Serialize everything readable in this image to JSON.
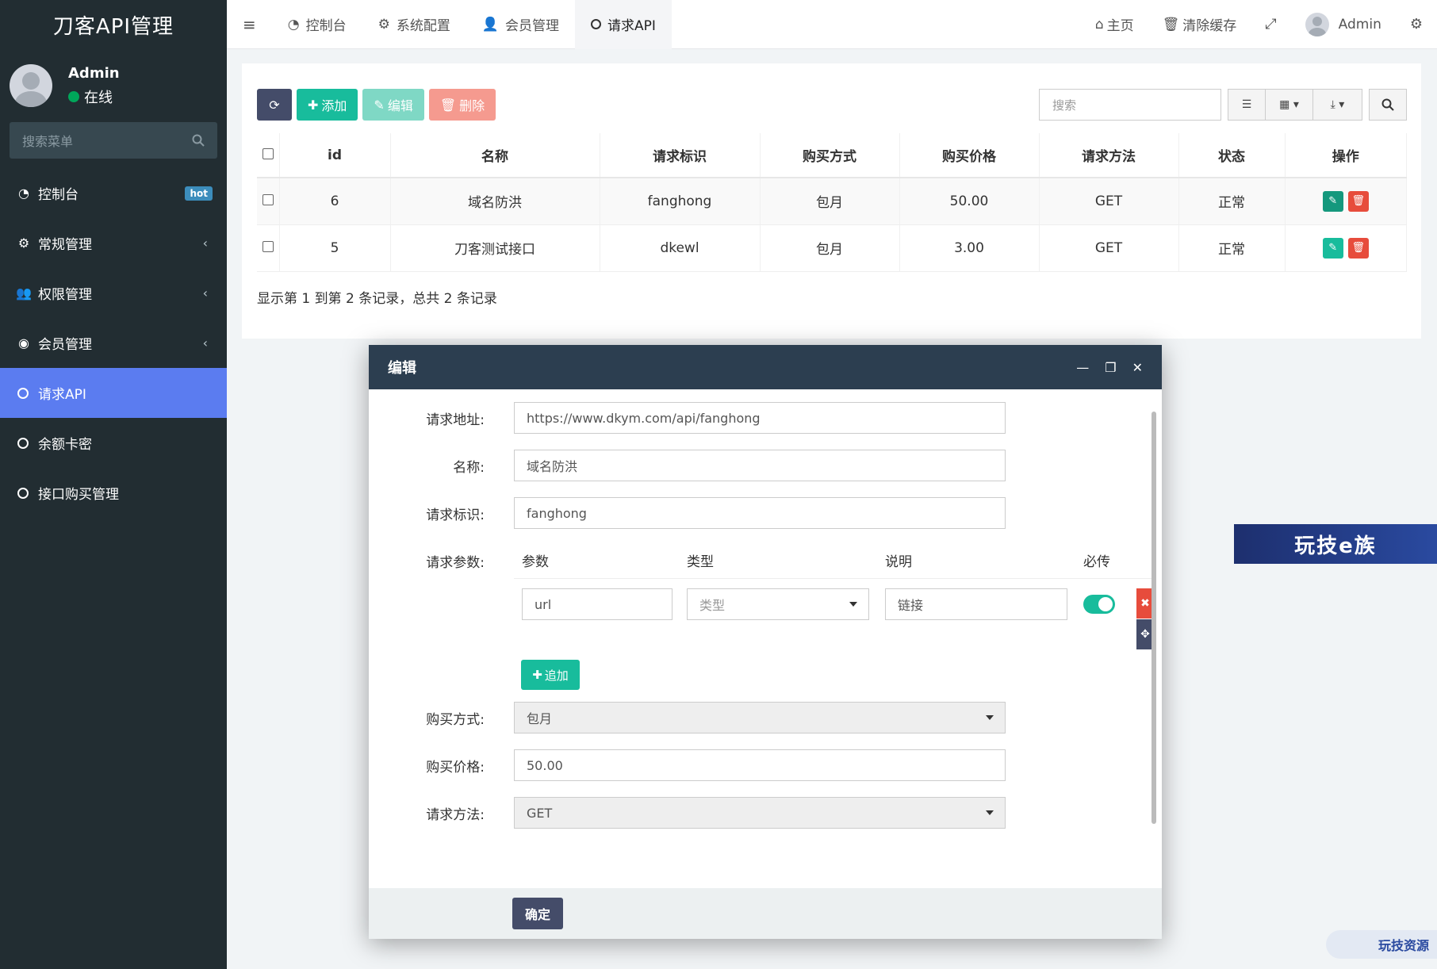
{
  "brand": {
    "title": "刀客API管理"
  },
  "user": {
    "name": "Admin",
    "status": "在线"
  },
  "sidebar": {
    "search_placeholder": "搜索菜单",
    "items": [
      {
        "label": "控制台",
        "icon": "dashboard-icon",
        "badge": "hot"
      },
      {
        "label": "常规管理",
        "icon": "cogs-icon"
      },
      {
        "label": "权限管理",
        "icon": "users-icon"
      },
      {
        "label": "会员管理",
        "icon": "user-circle-icon"
      },
      {
        "label": "请求API",
        "icon": "circle-icon",
        "active": true
      },
      {
        "label": "余额卡密",
        "icon": "circle-icon"
      },
      {
        "label": "接口购买管理",
        "icon": "circle-icon"
      }
    ]
  },
  "topbar": {
    "tabs": [
      {
        "label": "控制台",
        "icon": "dashboard-icon"
      },
      {
        "label": "系统配置",
        "icon": "gear-icon"
      },
      {
        "label": "会员管理",
        "icon": "user-icon"
      },
      {
        "label": "请求API",
        "icon": "circle-icon",
        "active": true
      }
    ],
    "home": "主页",
    "clear_cache": "清除缓存",
    "username": "Admin"
  },
  "toolbar": {
    "add_label": "添加",
    "edit_label": "编辑",
    "delete_label": "删除",
    "search_placeholder": "搜索"
  },
  "table": {
    "columns": [
      "id",
      "名称",
      "请求标识",
      "购买方式",
      "购买价格",
      "请求方法",
      "状态",
      "操作"
    ],
    "rows": [
      {
        "id": "6",
        "name": "域名防洪",
        "key": "fanghong",
        "buy_type": "包月",
        "price": "50.00",
        "method": "GET",
        "status": "正常"
      },
      {
        "id": "5",
        "name": "刀客测试接口",
        "key": "dkewl",
        "buy_type": "包月",
        "price": "3.00",
        "method": "GET",
        "status": "正常"
      }
    ],
    "summary": "显示第 1 到第 2 条记录，总共 2 条记录"
  },
  "modal": {
    "title": "编辑",
    "fields": {
      "url_label": "请求地址:",
      "url_value": "https://www.dkym.com/api/fanghong",
      "name_label": "名称:",
      "name_value": "域名防洪",
      "key_label": "请求标识:",
      "key_value": "fanghong",
      "params_label": "请求参数:",
      "buy_type_label": "购买方式:",
      "buy_type_value": "包月",
      "price_label": "购买价格:",
      "price_value": "50.00",
      "method_label": "请求方法:",
      "method_value": "GET"
    },
    "params": {
      "head": [
        "参数",
        "类型",
        "说明",
        "必传"
      ],
      "row": {
        "param": "url",
        "type_placeholder": "类型",
        "desc": "链接",
        "required": true
      },
      "append_label": "追加"
    },
    "confirm_label": "确定"
  },
  "watermark": {
    "banner": "玩技e族",
    "corner": "玩技资源"
  },
  "colors": {
    "sidebar": "#222d32",
    "active": "#5b7cf0",
    "primary": "#18bc9c",
    "danger": "#e74c3c",
    "dark_button": "#444c69"
  }
}
